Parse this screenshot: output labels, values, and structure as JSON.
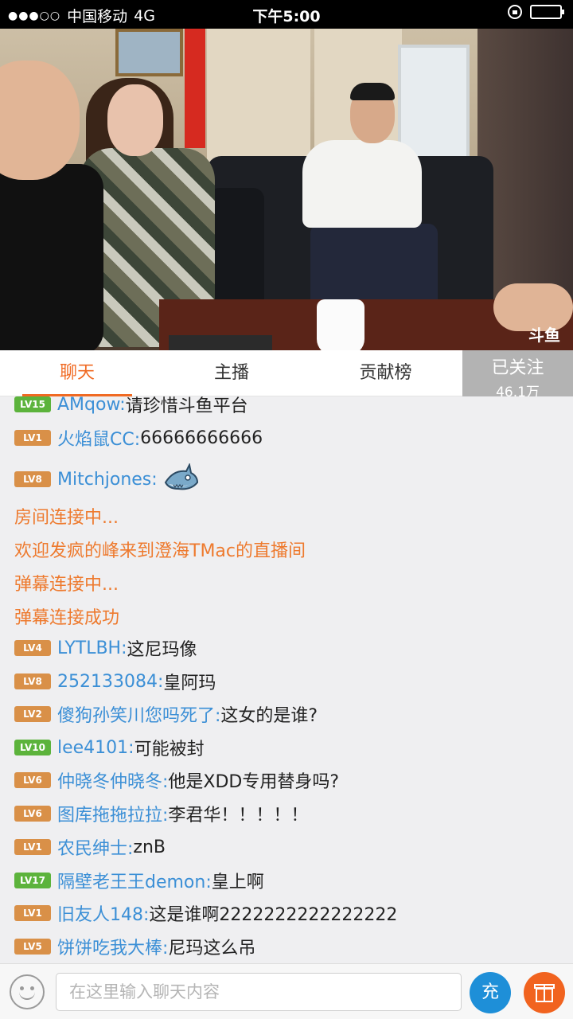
{
  "status_bar": {
    "carrier": "中国移动",
    "network": "4G",
    "time": "下午5:00",
    "signal_dots": "●●●○○"
  },
  "video": {
    "watermark": "斗鱼"
  },
  "tabs": [
    {
      "label": "聊天",
      "active": true
    },
    {
      "label": "主播",
      "active": false
    },
    {
      "label": "贡献榜",
      "active": false
    }
  ],
  "follow": {
    "label": "已关注",
    "count": "46.1万"
  },
  "chat": {
    "messages": [
      {
        "type": "user",
        "level": "LV15",
        "level_color": "green",
        "name": "AMqow:",
        "text": "请珍惜斗鱼平台"
      },
      {
        "type": "user",
        "level": "LV1",
        "level_color": "orange",
        "name": "火焰鼠CC:",
        "text": "66666666666"
      },
      {
        "type": "user",
        "level": "LV8",
        "level_color": "orange",
        "name": "Mitchjones:",
        "text": "",
        "emoji": "shark-emoji"
      },
      {
        "type": "system",
        "text": "房间连接中..."
      },
      {
        "type": "system",
        "text": "欢迎发疯的峰来到澄海TMac的直播间"
      },
      {
        "type": "system",
        "text": "弹幕连接中..."
      },
      {
        "type": "system",
        "text": "弹幕连接成功"
      },
      {
        "type": "user",
        "level": "LV4",
        "level_color": "orange",
        "name": "LYTLBH:",
        "text": "这尼玛像"
      },
      {
        "type": "user",
        "level": "LV8",
        "level_color": "orange",
        "name": "252133084:",
        "text": "皇阿玛"
      },
      {
        "type": "user",
        "level": "LV2",
        "level_color": "orange",
        "name": "傻狗孙笑川您吗死了:",
        "text": "这女的是谁?"
      },
      {
        "type": "user",
        "level": "LV10",
        "level_color": "green",
        "name": "lee4101:",
        "text": "可能被封"
      },
      {
        "type": "user",
        "level": "LV6",
        "level_color": "orange",
        "name": "仲晓冬仲晓冬:",
        "text": "他是XDD专用替身吗?"
      },
      {
        "type": "user",
        "level": "LV6",
        "level_color": "orange",
        "name": "图库拖拖拉拉:",
        "text": "李君华！！！！！"
      },
      {
        "type": "user",
        "level": "LV1",
        "level_color": "orange",
        "name": "农民绅士:",
        "text": "znB"
      },
      {
        "type": "user",
        "level": "LV17",
        "level_color": "green",
        "name": "隔壁老王王demon:",
        "text": "皇上啊"
      },
      {
        "type": "user",
        "level": "LV1",
        "level_color": "orange",
        "name": "旧友人148:",
        "text": "这是谁啊2222222222222222"
      },
      {
        "type": "user",
        "level": "LV5",
        "level_color": "orange",
        "name": "饼饼吃我大棒:",
        "text": "尼玛这么吊"
      }
    ]
  },
  "bottom_bar": {
    "input_placeholder": "在这里输入聊天内容",
    "recharge_label": "充"
  }
}
